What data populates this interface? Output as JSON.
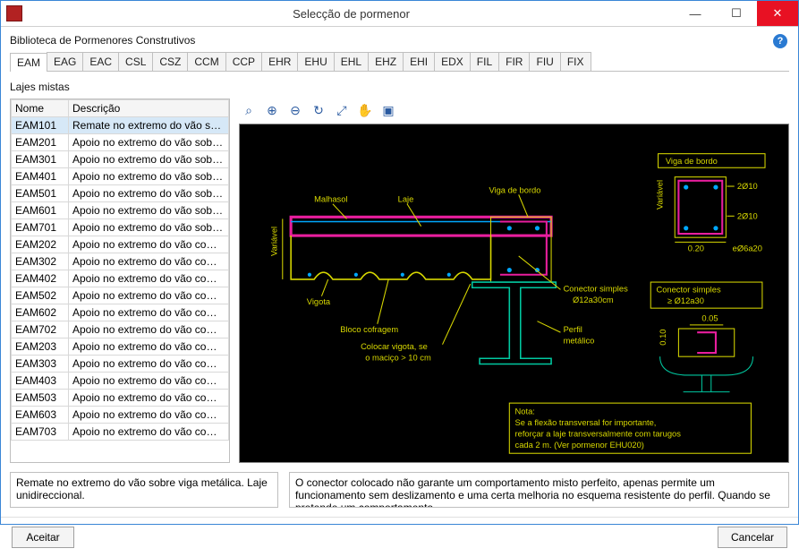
{
  "window": {
    "title": "Selecção de pormenor"
  },
  "header": {
    "library_label": "Biblioteca de Pormenores Construtivos"
  },
  "tabs": [
    "EAM",
    "EAG",
    "EAC",
    "CSL",
    "CSZ",
    "CCM",
    "CCP",
    "EHR",
    "EHU",
    "EHL",
    "EHZ",
    "EHI",
    "EDX",
    "FIL",
    "FIR",
    "FIU",
    "FIX"
  ],
  "active_tab": 0,
  "section_label": "Lajes mistas",
  "columns": {
    "name": "Nome",
    "desc": "Descrição"
  },
  "rows": [
    {
      "name": "EAM101",
      "desc": "Remate no extremo do vão sobr..."
    },
    {
      "name": "EAM201",
      "desc": "Apoio no extremo do vão sobre ..."
    },
    {
      "name": "EAM301",
      "desc": "Apoio no extremo do vão sobre ..."
    },
    {
      "name": "EAM401",
      "desc": "Apoio no extremo do vão sobre ..."
    },
    {
      "name": "EAM501",
      "desc": "Apoio no extremo do vão sobre ..."
    },
    {
      "name": "EAM601",
      "desc": "Apoio no extremo do vão sobre ..."
    },
    {
      "name": "EAM701",
      "desc": "Apoio no extremo do vão sobre ..."
    },
    {
      "name": "EAM202",
      "desc": "Apoio no extremo do vão com la..."
    },
    {
      "name": "EAM302",
      "desc": "Apoio no extremo do vão com la..."
    },
    {
      "name": "EAM402",
      "desc": "Apoio no extremo do vão com la..."
    },
    {
      "name": "EAM502",
      "desc": "Apoio no extremo do vão com la..."
    },
    {
      "name": "EAM602",
      "desc": "Apoio no extremo do vão com la..."
    },
    {
      "name": "EAM702",
      "desc": "Apoio no extremo do vão com la..."
    },
    {
      "name": "EAM203",
      "desc": "Apoio no extremo do vão com la..."
    },
    {
      "name": "EAM303",
      "desc": "Apoio no extremo do vão com la..."
    },
    {
      "name": "EAM403",
      "desc": "Apoio no extremo do vão com la..."
    },
    {
      "name": "EAM503",
      "desc": "Apoio no extremo do vão com la..."
    },
    {
      "name": "EAM603",
      "desc": "Apoio no extremo do vão com la..."
    },
    {
      "name": "EAM703",
      "desc": "Apoio no extremo do vão com la..."
    }
  ],
  "selected_row": 0,
  "toolbar_icons": [
    "zoom-window",
    "zoom-in",
    "zoom-out",
    "zoom-extents",
    "zoom-real",
    "pan",
    "redraw"
  ],
  "drawing_labels": {
    "malhasol": "Malhasol",
    "laje": "Laje",
    "viga_bordo": "Viga de bordo",
    "variavel": "Variável",
    "vigota": "Vigota",
    "bloco": "Bloco cofragem",
    "colocar1": "Colocar vigota, se",
    "colocar2": "o maciço > 10 cm",
    "conector1": "Conector simples",
    "conector2": "Ø12a30cm",
    "perfil1": "Perfil",
    "perfil2": "metálico",
    "right_title": "Viga de bordo",
    "right_val1": "2Ø10",
    "right_val2": "2Ø10",
    "right_dim1": "0.20",
    "right_dim2": "eØ6a20",
    "detail_title": "Conector simples",
    "detail_sub": "≥ Ø12a30",
    "detail_dim1": "0.05",
    "detail_dim2": "0.10",
    "note_title": "Nota:",
    "note_l1": "Se a flexão transversal for importante,",
    "note_l2": "reforçar a laje transversalmente com tarugos",
    "note_l3": "cada 2 m. (Ver pormenor EHU020)"
  },
  "desc_left": "Remate no extremo do vão sobre viga metálica. Laje unidireccional.",
  "desc_right": "O conector colocado não garante um comportamento misto perfeito, apenas permite um funcionamento sem deslizamento e uma certa melhoria no esquema resistente do perfil. Quando se pretende um comportamento",
  "buttons": {
    "accept": "Aceitar",
    "cancel": "Cancelar"
  }
}
